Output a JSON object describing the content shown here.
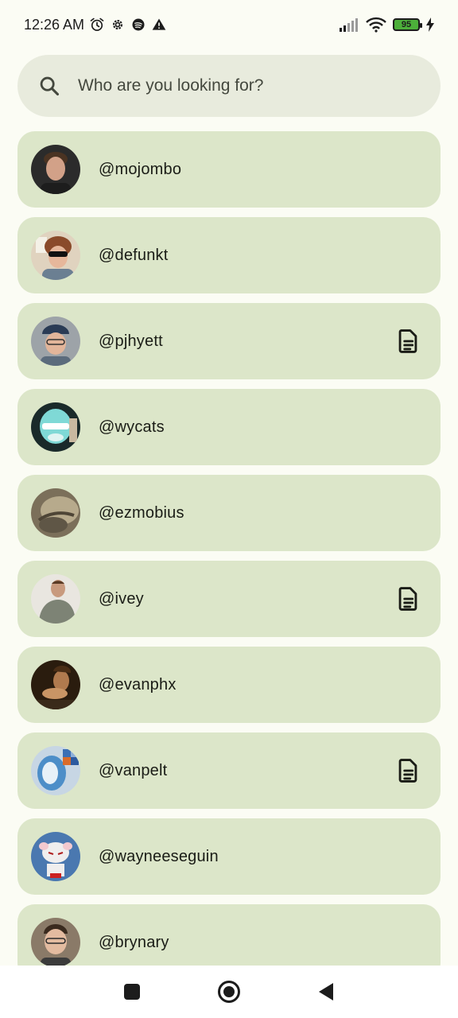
{
  "status_bar": {
    "time": "12:26 AM",
    "battery_level": "95",
    "icons_left": [
      "alarm-icon",
      "settings-gear-icon",
      "spotify-icon",
      "warning-icon"
    ],
    "icons_right": [
      "signal-icon",
      "wifi-icon",
      "battery-icon",
      "charging-icon"
    ]
  },
  "search": {
    "placeholder": "Who are you looking for?",
    "value": ""
  },
  "users": [
    {
      "handle": "@mojombo",
      "has_document": false
    },
    {
      "handle": "@defunkt",
      "has_document": false
    },
    {
      "handle": "@pjhyett",
      "has_document": true
    },
    {
      "handle": "@wycats",
      "has_document": false
    },
    {
      "handle": "@ezmobius",
      "has_document": false
    },
    {
      "handle": "@ivey",
      "has_document": true
    },
    {
      "handle": "@evanphx",
      "has_document": false
    },
    {
      "handle": "@vanpelt",
      "has_document": true
    },
    {
      "handle": "@wayneeseguin",
      "has_document": false
    },
    {
      "handle": "@brynary",
      "has_document": false
    }
  ],
  "colors": {
    "background": "#fbfcf4",
    "card": "#dce6c9",
    "search_bg": "#e8ebdd",
    "text": "#1a1c16"
  },
  "nav_bar": {
    "buttons": [
      "recents-square-icon",
      "home-circle-icon",
      "back-triangle-icon"
    ]
  }
}
